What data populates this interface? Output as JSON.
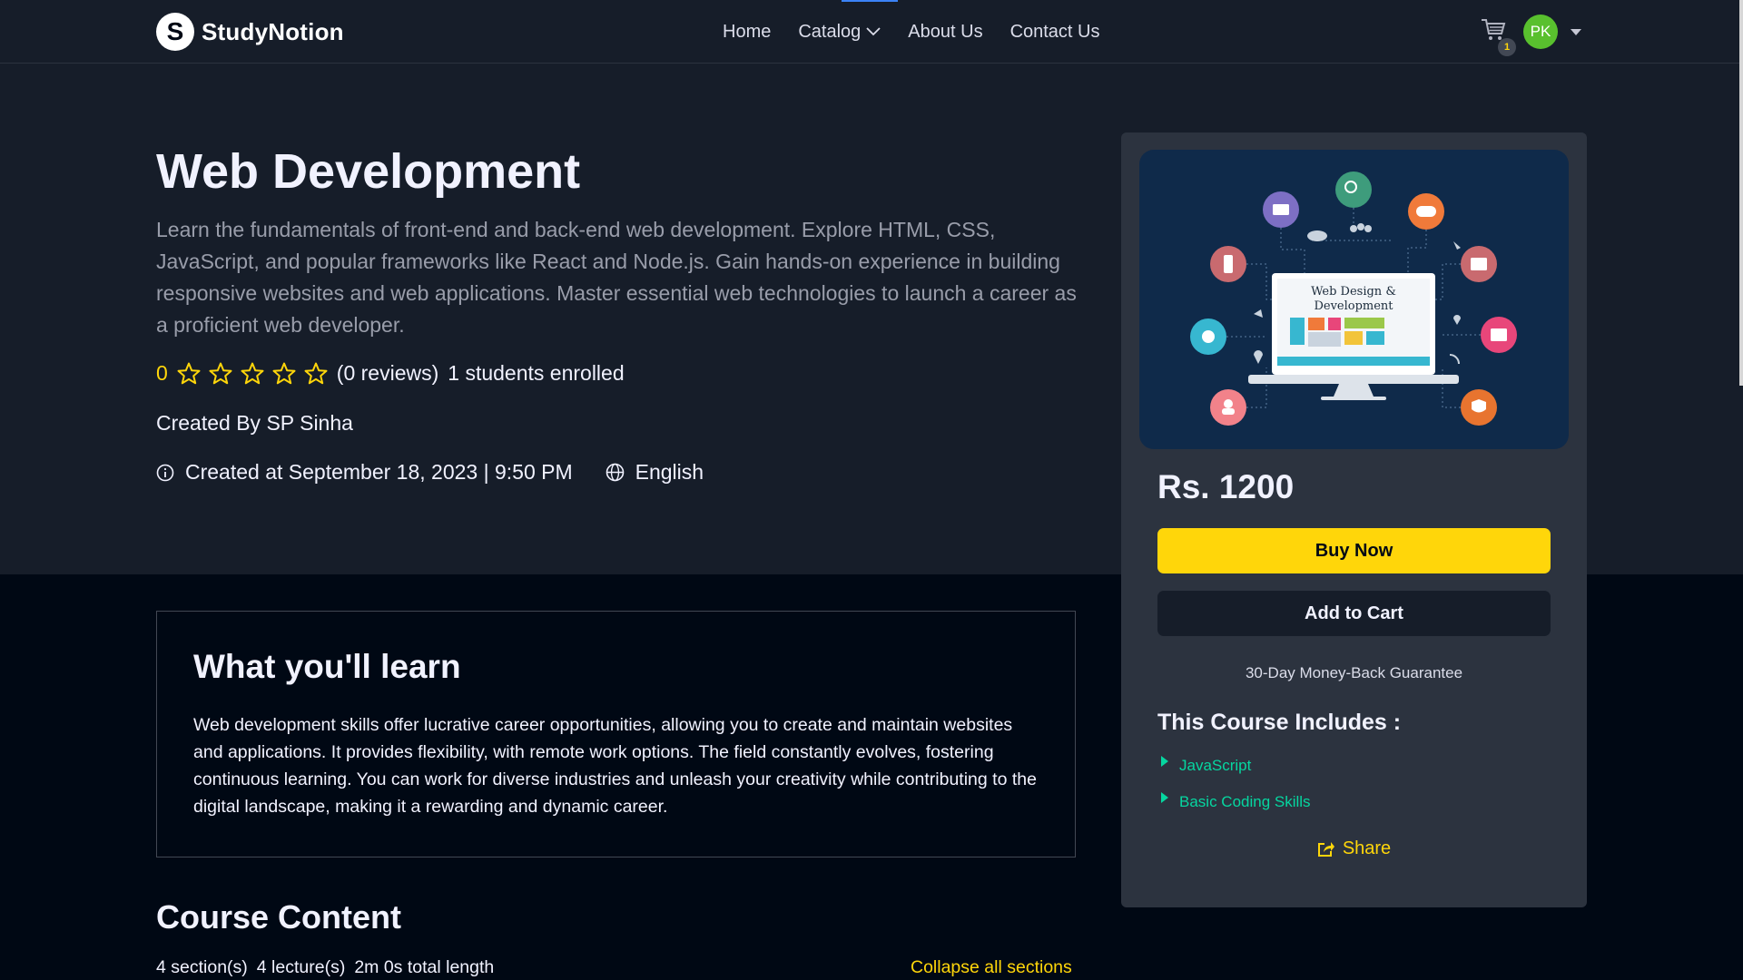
{
  "brand": {
    "name": "StudyNotion",
    "mark": "S"
  },
  "nav": {
    "links": [
      {
        "label": "Home"
      },
      {
        "label": "Catalog"
      },
      {
        "label": "About Us"
      },
      {
        "label": "Contact Us"
      }
    ],
    "cart_count": "1",
    "avatar_initials": "PK"
  },
  "course": {
    "title": "Web Development",
    "description": "Learn the fundamentals of front-end and back-end web development. Explore HTML, CSS, JavaScript, and popular frameworks like React and Node.js. Gain hands-on experience in building responsive websites and web applications. Master essential web technologies to launch a career as a proficient web developer.",
    "rating": "0",
    "stars_filled": 0,
    "stars_total": 5,
    "reviews": "(0 reviews)",
    "enrolled": "1 students enrolled",
    "created_by": "Created By SP Sinha",
    "created_at": "Created at September 18, 2023 | 9:50 PM",
    "language": "English"
  },
  "card": {
    "thumbnail_caption": "Web Design & Development",
    "price": "Rs. 1200",
    "buy_label": "Buy Now",
    "cart_label": "Add to Cart",
    "guarantee": "30-Day Money-Back Guarantee",
    "includes_title": "This Course Includes :",
    "includes": [
      "JavaScript",
      "Basic Coding Skills"
    ],
    "share_label": "Share"
  },
  "learn": {
    "title": "What you'll learn",
    "text": "Web development skills offer lucrative career opportunities, allowing you to create and maintain websites and applications. It provides flexibility, with remote work options. The field constantly evolves, fostering continuous learning. You can work for diverse industries and unleash your creativity while contributing to the digital landscape, making it a rewarding and dynamic career."
  },
  "content": {
    "title": "Course Content",
    "sections": "4 section(s)",
    "lectures": "4 lecture(s)",
    "length": "2m 0s total length",
    "collapse_label": "Collapse all sections"
  },
  "colors": {
    "accent_yellow": "#FFD60A",
    "accent_green": "#06D6A0",
    "bg_dark": "#000814",
    "bg_panel": "#161D29",
    "card_bg": "#2C333F"
  }
}
